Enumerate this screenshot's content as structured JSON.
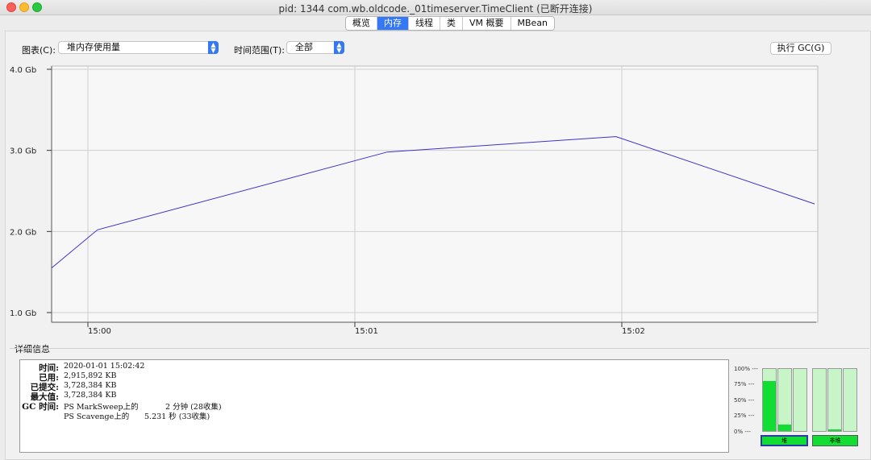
{
  "window": {
    "title": "pid: 1344 com.wb.oldcode._01timeserver.TimeClient (已断开连接)"
  },
  "tabs": [
    {
      "label": "概览",
      "active": false
    },
    {
      "label": "内存",
      "active": true
    },
    {
      "label": "线程",
      "active": false
    },
    {
      "label": "类",
      "active": false
    },
    {
      "label": "VM 概要",
      "active": false
    },
    {
      "label": "MBean",
      "active": false
    }
  ],
  "toolbar": {
    "chart_label": "图表(C):",
    "chart_value": "堆内存使用量",
    "range_label": "时间范围(T):",
    "range_value": "全部",
    "gc_button": "执行 GC(G)"
  },
  "chart_data": {
    "type": "line",
    "y_ticks": [
      "4.0 Gb",
      "3.0 Gb",
      "2.0 Gb",
      "1.0 Gb"
    ],
    "x_ticks": [
      "15:00",
      "15:01",
      "15:02"
    ],
    "ylim": [
      1.0,
      4.0
    ],
    "series": [
      {
        "color": "#3b33c9",
        "points": [
          [
            0.0,
            1.55
          ],
          [
            0.06,
            2.02
          ],
          [
            0.44,
            2.98
          ],
          [
            0.74,
            3.17
          ],
          [
            1.0,
            2.34
          ]
        ]
      }
    ]
  },
  "details": {
    "title": "详细信息",
    "rows": [
      {
        "key": "时间:",
        "value": "2020-01-01 15:02:42"
      },
      {
        "key": "已用:",
        "value": "2,915,892 KB"
      },
      {
        "key": "已提交:",
        "value": "3,728,384 KB"
      },
      {
        "key": "最大值:",
        "value": "3,728,384 KB"
      },
      {
        "key": "GC 时间:",
        "value": "PS MarkSweep上的",
        "extra": "2 分钟 (28收集)"
      },
      {
        "key": "",
        "value": "PS Scavenge上的",
        "extra": "5.231 秒 (33收集)"
      }
    ]
  },
  "pools": {
    "percent_labels": [
      "100% ---",
      "75% ---",
      "50% ---",
      "25% ---",
      "0% ---"
    ],
    "heap_fill": [
      0.8,
      0.1,
      0.0
    ],
    "nonheap_fill": [
      0.0,
      0.03,
      0.0
    ],
    "heap_label": "堆",
    "nonheap_label": "非堆",
    "fill_color": "#11dd33"
  }
}
